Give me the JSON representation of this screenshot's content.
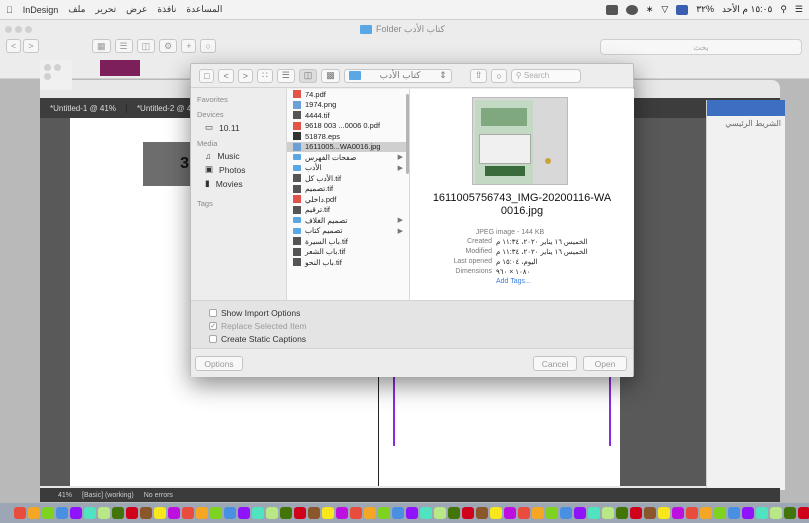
{
  "menubar": {
    "items": [
      "المساعدة",
      "نافذة",
      "عرض",
      "تحرير",
      "ملف",
      "InDesign"
    ],
    "time": "١٥:٠٥ م الأحد",
    "battery": "٣٢%"
  },
  "finder": {
    "title": "Folder كتاب الأدب",
    "search_placeholder": "بحث"
  },
  "indesign": {
    "tabs": [
      "*Untitled-1 @ 41%",
      "*Untitled-2 @ 41%"
    ],
    "page_number": "3",
    "right_panel_title": "الشريط الرئيسي",
    "status_text": "[Basic] (working)",
    "errors": "No errors",
    "zoom": "41%"
  },
  "dialog": {
    "toolbar": {
      "location": "كتاب الأدب",
      "search_placeholder": "Search"
    },
    "sidebar": {
      "favorites_header": "Favorites",
      "devices_header": "Devices",
      "device": "10.11",
      "media_header": "Media",
      "media": [
        "Music",
        "Photos",
        "Movies"
      ],
      "tags_header": "Tags"
    },
    "files": [
      {
        "name": "74.pdf",
        "type": "pdf",
        "folder": false,
        "selected": false
      },
      {
        "name": "1974.png",
        "type": "img",
        "folder": false,
        "selected": false
      },
      {
        "name": "4444.tif",
        "type": "tif",
        "folder": false,
        "selected": false
      },
      {
        "name": "9618 003 ...0006 0.pdf",
        "type": "pdf",
        "folder": false,
        "selected": false
      },
      {
        "name": "51878.eps",
        "type": "eps",
        "folder": false,
        "selected": false
      },
      {
        "name": "1611005...WA0016.jpg",
        "type": "jpg",
        "folder": false,
        "selected": true
      },
      {
        "name": "صفحات الفهرس",
        "type": "folder",
        "folder": true,
        "selected": false
      },
      {
        "name": "الأدب",
        "type": "folder",
        "folder": true,
        "selected": false
      },
      {
        "name": "الأدب كل.tif",
        "type": "tif",
        "folder": false,
        "selected": false
      },
      {
        "name": "تصميم.tif",
        "type": "tif",
        "folder": false,
        "selected": false
      },
      {
        "name": "داخلي.pdf",
        "type": "pdf",
        "folder": false,
        "selected": false
      },
      {
        "name": "ترقيم.tif",
        "type": "tif",
        "folder": false,
        "selected": false
      },
      {
        "name": "تصميم الغلاف",
        "type": "folder",
        "folder": true,
        "selected": false
      },
      {
        "name": "تصميم كتاب",
        "type": "folder",
        "folder": true,
        "selected": false
      },
      {
        "name": "باب السيرة.tif",
        "type": "tif",
        "folder": false,
        "selected": false
      },
      {
        "name": "باب الشعر.tif",
        "type": "tif",
        "folder": false,
        "selected": false
      },
      {
        "name": "باب النحو.tif",
        "type": "tif",
        "folder": false,
        "selected": false
      }
    ],
    "preview": {
      "name": "1611005756743_IMG-20200116-WA0016.jpg",
      "kind": "JPEG image - 144 KB",
      "created_label": "Created",
      "created": "الخميس ١٦ يناير ٢٠٢٠، ١١:٣٤ م",
      "modified_label": "Modified",
      "modified": "الخميس ١٦ يناير ٢٠٢٠، ١١:٣٤ م",
      "opened_label": "Last opened",
      "opened": "اليوم، ١٥:٠٤ م",
      "dimensions_label": "Dimensions",
      "dimensions": "١٠٨٠ × ٩٦٠",
      "add_tags": "Add Tags..."
    },
    "options": {
      "show_import": "Show Import Options",
      "replace_selected": "Replace Selected Item",
      "create_static": "Create Static Captions"
    },
    "buttons": {
      "options": "Options",
      "cancel": "Cancel",
      "open": "Open"
    }
  }
}
